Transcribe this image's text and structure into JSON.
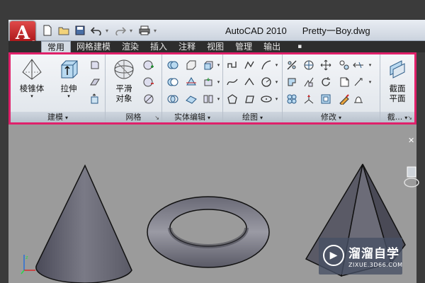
{
  "window": {
    "app_name": "AutoCAD 2010",
    "file_name": "Pretty一Boy.dwg"
  },
  "app_button": {
    "glyph": "A",
    "dropdown": "▾"
  },
  "quick_access": {
    "icons": [
      "new-icon",
      "open-icon",
      "save-icon",
      "undo-icon",
      "redo-icon",
      "plot-icon"
    ]
  },
  "ribbon_tabs": [
    {
      "label": "常用",
      "active": true
    },
    {
      "label": "网格建模",
      "active": false
    },
    {
      "label": "渲染",
      "active": false
    },
    {
      "label": "插入",
      "active": false
    },
    {
      "label": "注释",
      "active": false
    },
    {
      "label": "视图",
      "active": false
    },
    {
      "label": "管理",
      "active": false
    },
    {
      "label": "输出",
      "active": false
    }
  ],
  "ribbon_extra_icon": "▪",
  "panels": {
    "modeling": {
      "title": "建模",
      "cone_label": "棱锥体",
      "extrude_label": "拉伸"
    },
    "mesh": {
      "title": "网格",
      "smooth_label_1": "平滑",
      "smooth_label_2": "对象"
    },
    "solid_edit": {
      "title": "实体编辑"
    },
    "draw": {
      "title": "绘图"
    },
    "modify": {
      "title": "修改"
    },
    "section": {
      "title": "截...",
      "label_1": "截面",
      "label_2": "平面"
    }
  },
  "watermark": {
    "logo_glyph": "▶",
    "title": "溜溜自学",
    "url": "ZIXUE.3D66.COM"
  },
  "colors": {
    "highlight": "#e0206a",
    "viewport_bg": "#9b9b9b"
  }
}
